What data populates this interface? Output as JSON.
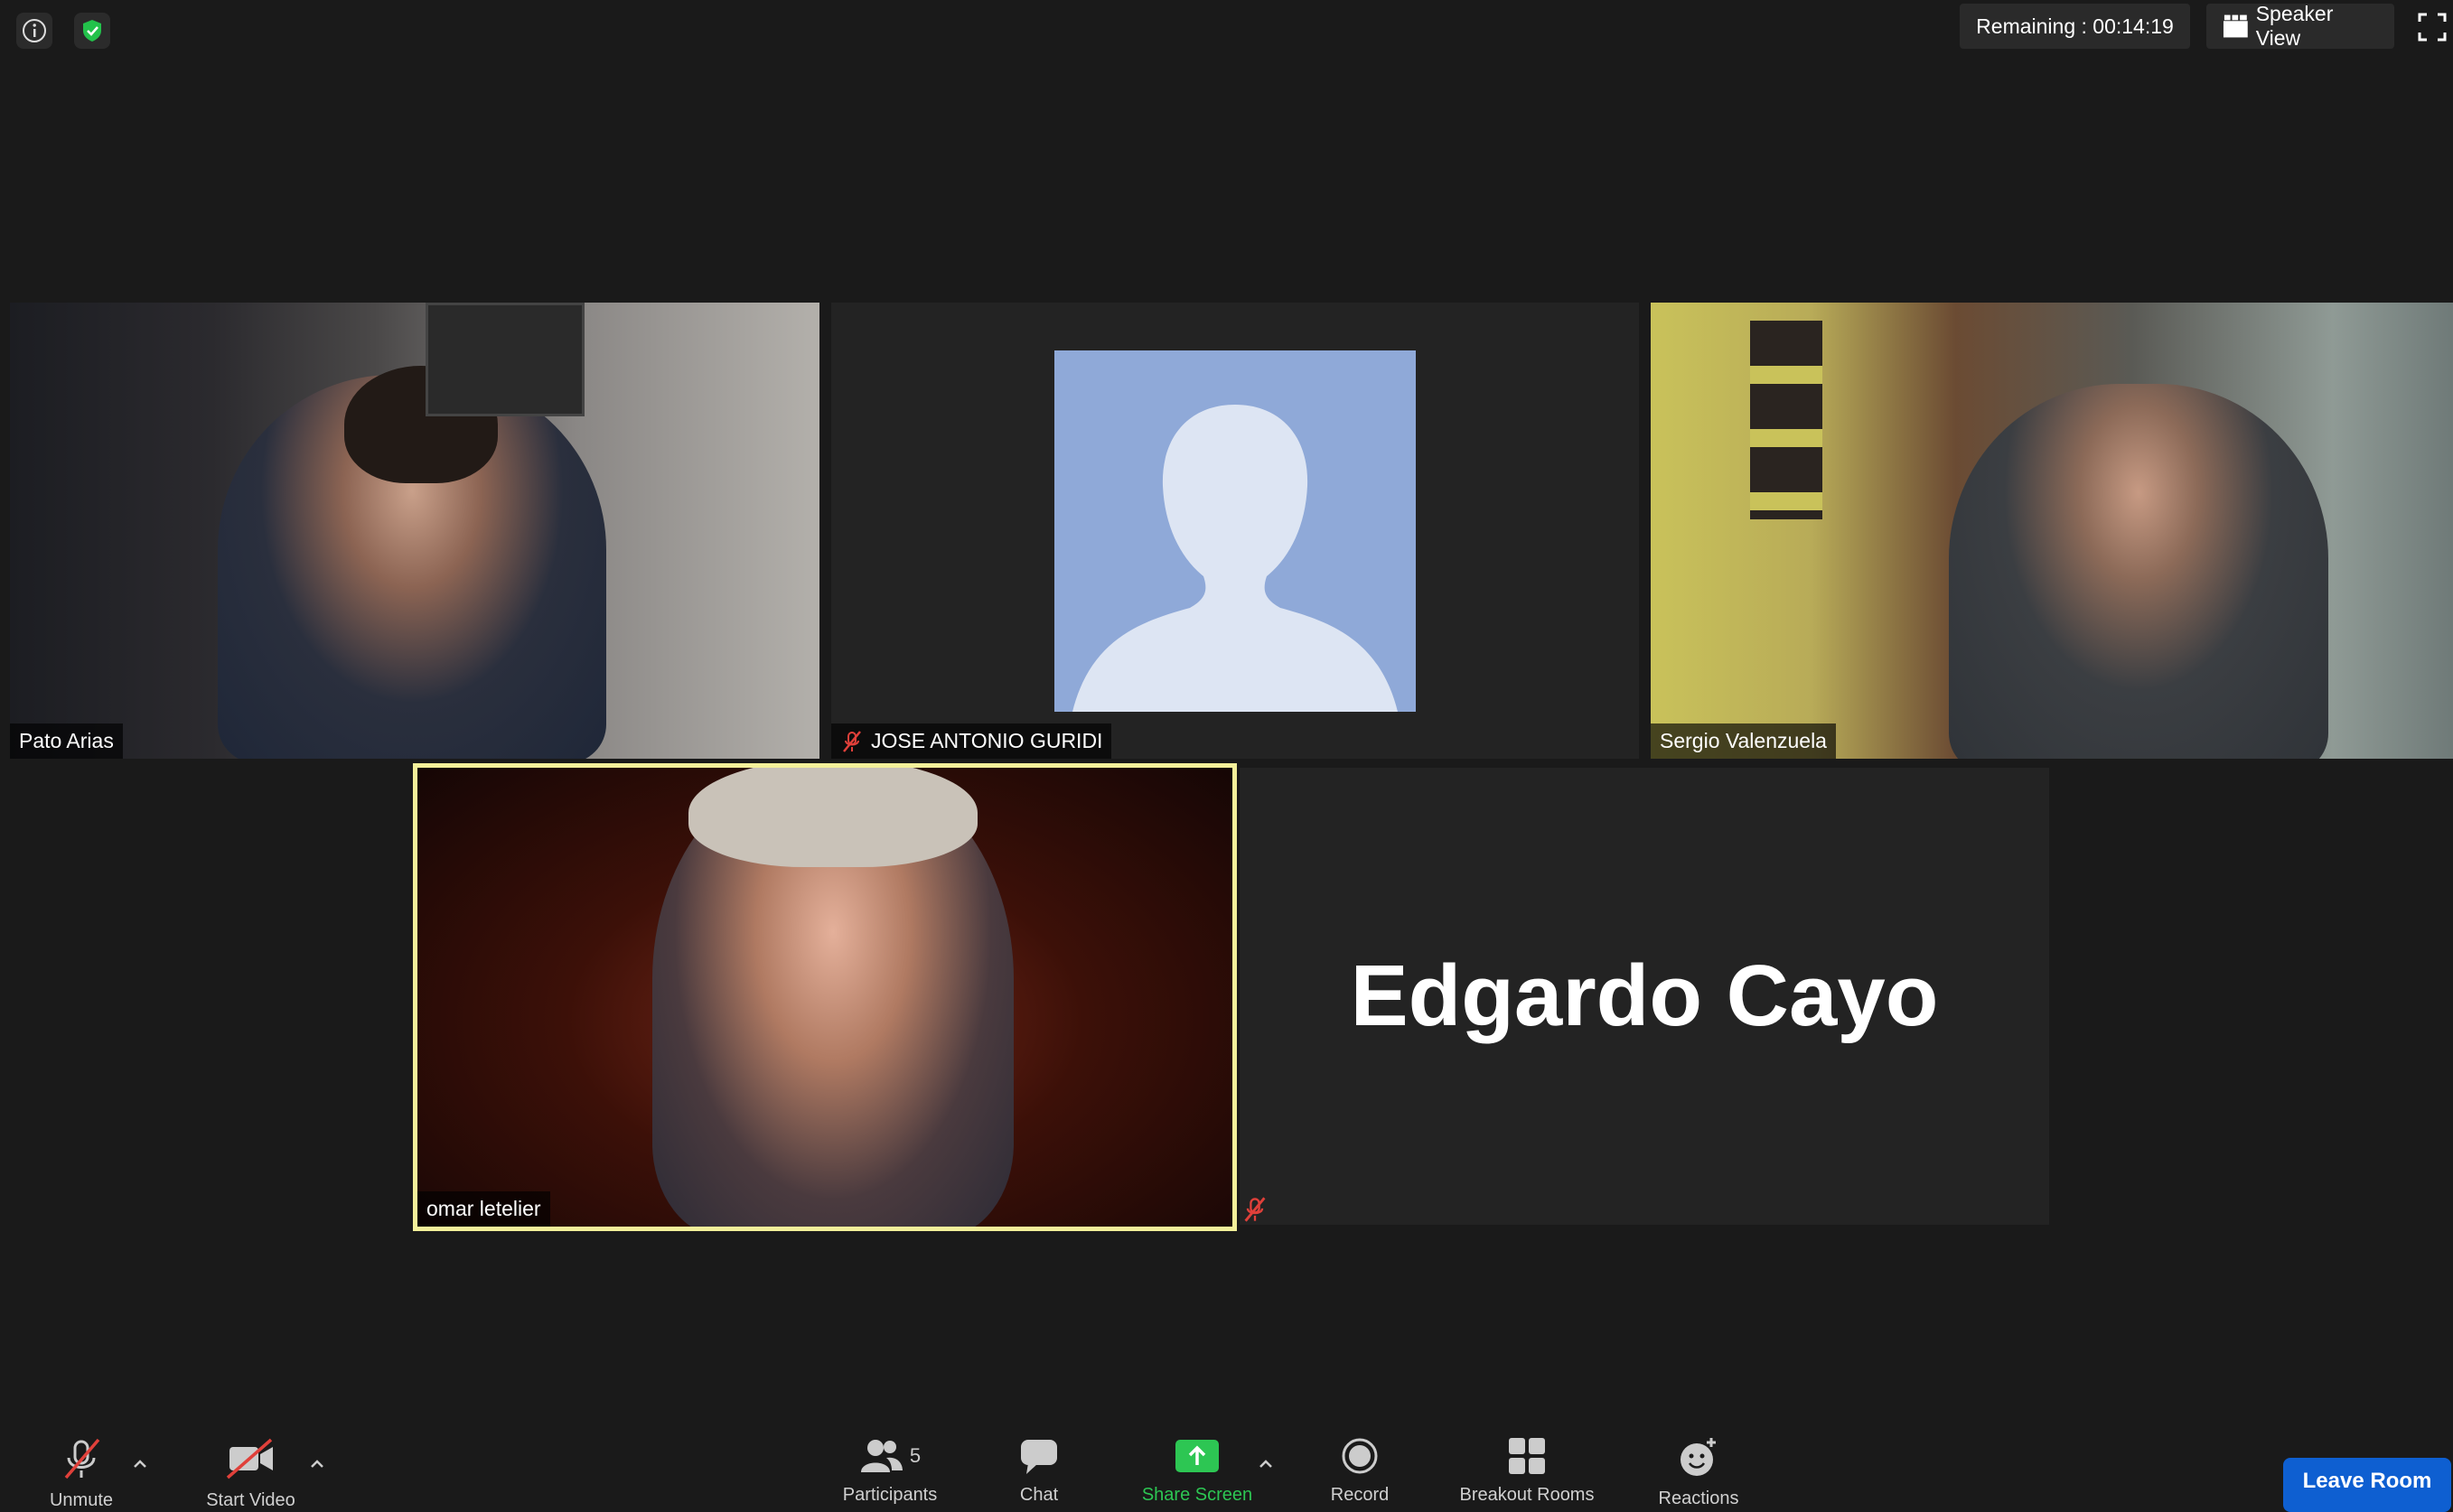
{
  "topbar": {
    "remaining_text": "Remaining : 00:14:19",
    "view_label": "Speaker View",
    "icons": [
      "info-icon",
      "shield-check-icon",
      "speaker-view-icon",
      "fullscreen-icon"
    ]
  },
  "participants": [
    {
      "name": "Pato Arias",
      "muted": false,
      "video": true
    },
    {
      "name": "JOSE ANTONIO GURIDI",
      "muted": true,
      "video": false
    },
    {
      "name": "Sergio Valenzuela",
      "muted": false,
      "video": true
    },
    {
      "name": "omar letelier",
      "muted": false,
      "video": true,
      "active_speaker": true
    },
    {
      "name": "Edgardo Cayo",
      "muted": true,
      "video": false
    }
  ],
  "toolbar": {
    "mute_label": "Unmute",
    "video_label": "Start Video",
    "participants_label": "Participants",
    "participants_count": "5",
    "chat_label": "Chat",
    "share_label": "Share Screen",
    "record_label": "Record",
    "breakout_label": "Breakout Rooms",
    "reactions_label": "Reactions",
    "leave_label": "Leave Room"
  },
  "colors": {
    "background": "#1a1a1a",
    "tile": "#232323",
    "active_speaker_border": "#f3f09a",
    "share_green": "#2dc653",
    "leave_blue": "#0e5fd1",
    "muted_red": "#e0403a"
  }
}
